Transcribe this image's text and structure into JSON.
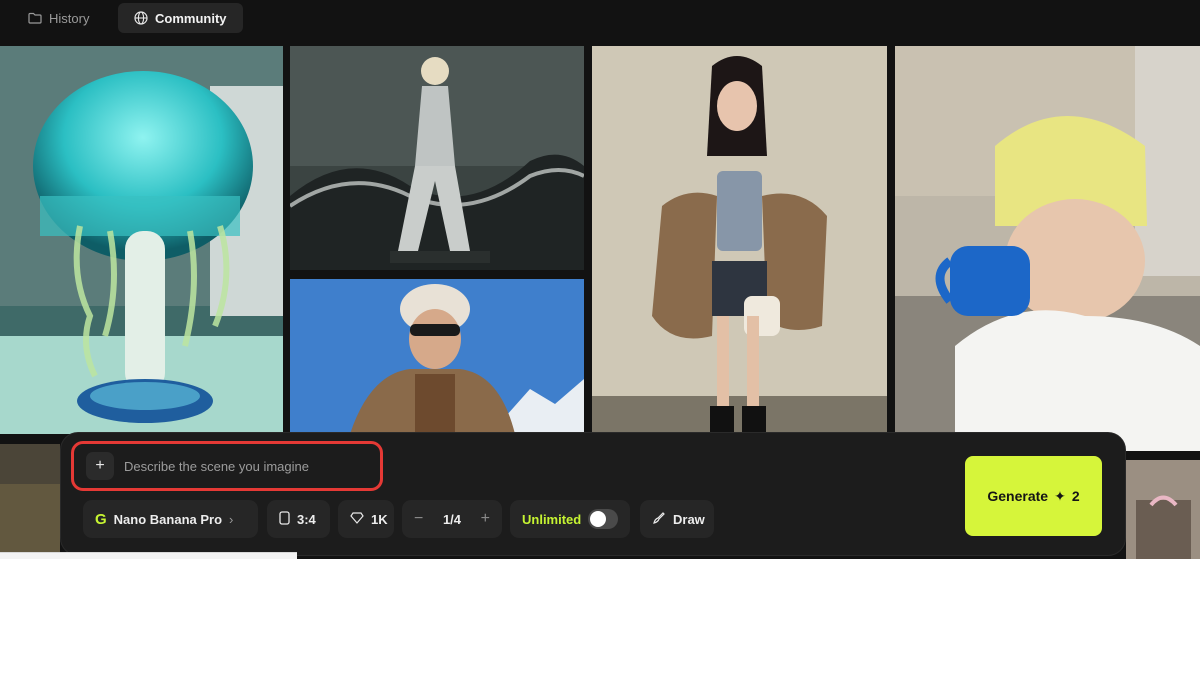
{
  "tabs": [
    {
      "label": "History",
      "icon": "folder-icon",
      "active": false
    },
    {
      "label": "Community",
      "icon": "globe-icon",
      "active": true
    }
  ],
  "prompt": {
    "placeholder": "Describe the scene you imagine",
    "value": ""
  },
  "controls": {
    "model_logo": "G",
    "model": "Nano Banana Pro",
    "aspect_ratio": "3:4",
    "quality": "1K",
    "count": "1/4",
    "unlimited_label": "Unlimited",
    "unlimited_on": false,
    "draw_label": "Draw"
  },
  "generate": {
    "label": "Generate",
    "cost": "2"
  },
  "colors": {
    "accent": "#d6f53a",
    "background": "#121212",
    "panel": "#1c1c1c",
    "highlight": "#e53935"
  },
  "gallery": [
    {
      "subject": "glowing jellyfish lamp"
    },
    {
      "subject": "silver-clad figure on ocean wave"
    },
    {
      "subject": "woman in beanie and fur coat on mountain"
    },
    {
      "subject": "woman in corset and fur jacket by wall"
    },
    {
      "subject": "man in yellow beanie drinking from blue mug"
    }
  ]
}
